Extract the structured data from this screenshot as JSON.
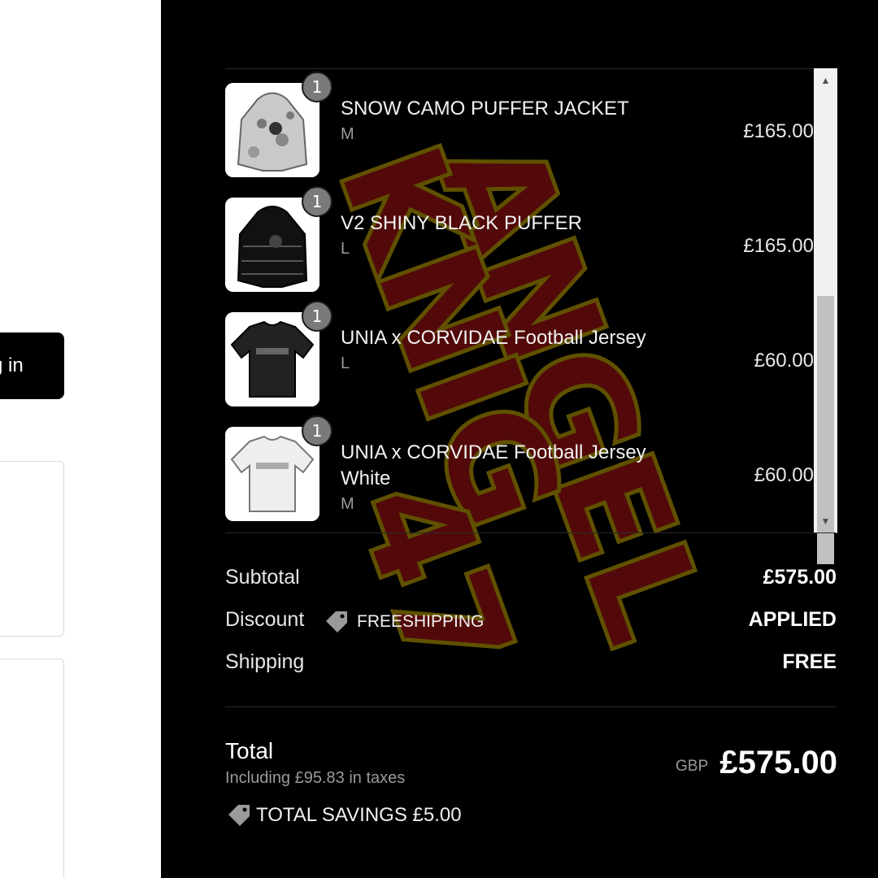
{
  "left": {
    "login_label": "g in"
  },
  "watermark": {
    "text": "ANGEL KNIGHT 47"
  },
  "items": [
    {
      "qty": "1",
      "name": "SNOW CAMO PUFFER JACKET",
      "variant": "M",
      "price": "£165.00",
      "image": "snow-camo-puffer-image"
    },
    {
      "qty": "1",
      "name": "V2 SHINY BLACK PUFFER",
      "variant": "L",
      "price": "£165.00",
      "image": "black-puffer-image"
    },
    {
      "qty": "1",
      "name": "UNIA x CORVIDAE Football Jersey",
      "variant": "L",
      "price": "£60.00",
      "image": "black-jersey-image"
    },
    {
      "qty": "1",
      "name": "UNIA x CORVIDAE Football Jersey White",
      "variant": "M",
      "price": "£60.00",
      "image": "white-jersey-image"
    }
  ],
  "summary": {
    "subtotal_label": "Subtotal",
    "subtotal_value": "£575.00",
    "discount_label": "Discount",
    "discount_code": "FREESHIPPING",
    "discount_value": "APPLIED",
    "shipping_label": "Shipping",
    "shipping_value": "FREE"
  },
  "total": {
    "label": "Total",
    "taxes": "Including £95.83 in taxes",
    "currency": "GBP",
    "value": "£575.00",
    "savings": "TOTAL SAVINGS £5.00"
  },
  "colors": {
    "panel_bg": "#000000",
    "watermark_fill": "#5c0a0a",
    "watermark_stroke": "#6b5a00"
  }
}
